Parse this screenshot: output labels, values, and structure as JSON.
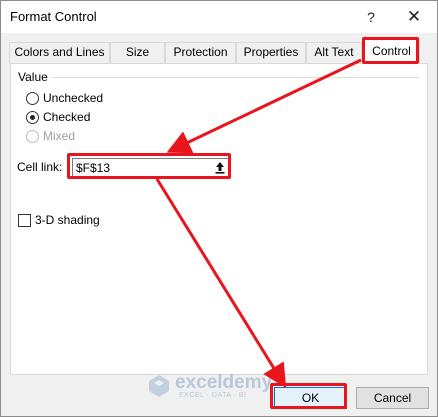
{
  "window": {
    "title": "Format Control",
    "help_label": "?",
    "close_label": "✕"
  },
  "tabs": [
    {
      "label": "Colors and Lines",
      "active": false
    },
    {
      "label": "Size",
      "active": false
    },
    {
      "label": "Protection",
      "active": false
    },
    {
      "label": "Properties",
      "active": false
    },
    {
      "label": "Alt Text",
      "active": false
    },
    {
      "label": "Control",
      "active": true
    }
  ],
  "value_group": {
    "label": "Value",
    "options": [
      {
        "label": "Unchecked",
        "selected": false,
        "enabled": true
      },
      {
        "label": "Checked",
        "selected": true,
        "enabled": true
      },
      {
        "label": "Mixed",
        "selected": false,
        "enabled": false
      }
    ]
  },
  "cell_link": {
    "label": "Cell link:",
    "value": "$F$13"
  },
  "shading": {
    "label": "3-D shading",
    "checked": false
  },
  "watermark": {
    "name": "exceldemy",
    "tagline": "EXCEL · DATA · BI"
  },
  "buttons": {
    "ok": "OK",
    "cancel": "Cancel"
  },
  "colors": {
    "annotation": "#e8141e",
    "active_tab_bg": "#ffffff",
    "panel_bg": "#ffffff",
    "dialog_bg": "#f0f0f0"
  }
}
